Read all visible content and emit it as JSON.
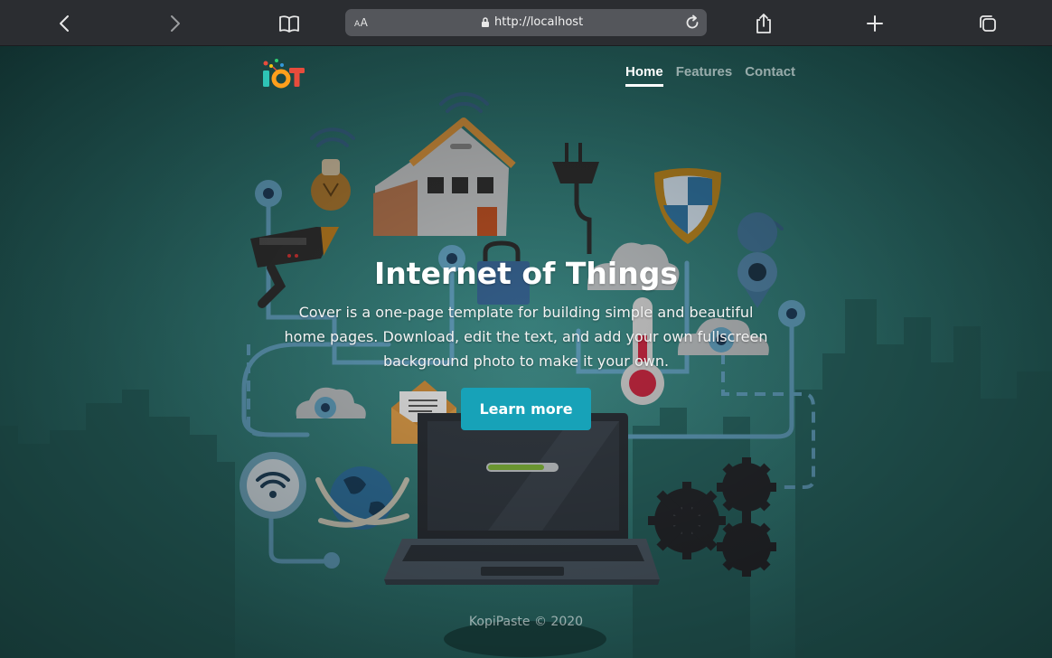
{
  "browser": {
    "url_aa": "AA",
    "url": "http://localhost"
  },
  "site": {
    "logo_text": "IoT",
    "nav": [
      {
        "label": "Home",
        "active": true
      },
      {
        "label": "Features",
        "active": false
      },
      {
        "label": "Contact",
        "active": false
      }
    ]
  },
  "hero": {
    "title": "Internet of Things",
    "lead": "Cover is a one-page template for building simple and beautiful home pages. Download, edit the text, and add your own fullscreen background photo to make it your own.",
    "button_label": "Learn more"
  },
  "footer": {
    "text": "KopiPaste © 2020"
  },
  "colors": {
    "background": "#2f7470",
    "accent_button": "#17a2b8",
    "toolbar": "#2b2d31"
  }
}
